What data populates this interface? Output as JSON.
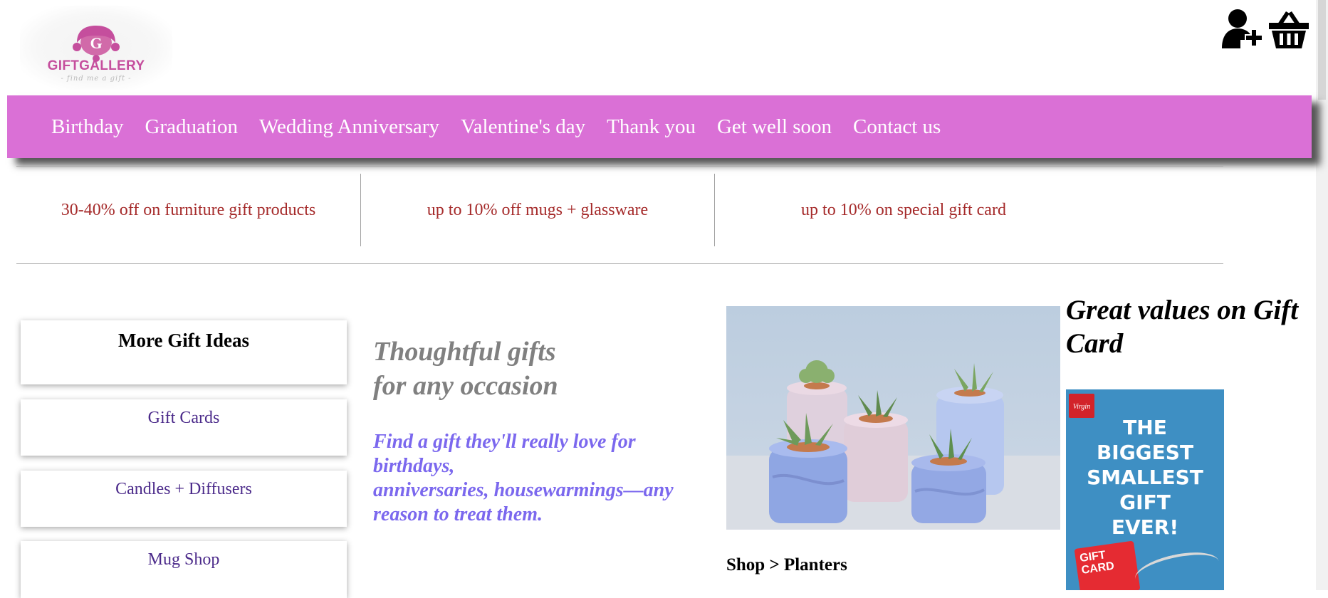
{
  "header": {
    "logo": {
      "brand": "GIFTGALLERY",
      "tagline": "- find me a gift -",
      "monogram": "G"
    },
    "icons": {
      "account": "add-user-icon",
      "cart": "basket-icon"
    }
  },
  "nav": {
    "items": [
      {
        "label": "Birthday"
      },
      {
        "label": "Graduation"
      },
      {
        "label": "Wedding Anniversary"
      },
      {
        "label": "Valentine's day"
      },
      {
        "label": "Thank you"
      },
      {
        "label": "Get well soon"
      },
      {
        "label": "Contact us"
      }
    ]
  },
  "promos": [
    {
      "text": "30-40% off on furniture gift products"
    },
    {
      "text": "up to 10% off mugs + glassware"
    },
    {
      "text": "up to 10% on special gift card"
    }
  ],
  "sidebar": {
    "title": "More Gift Ideas",
    "links": [
      {
        "label": "Gift Cards"
      },
      {
        "label": "Candles + Diffusers"
      },
      {
        "label": "Mug Shop"
      }
    ]
  },
  "hero": {
    "headline_line1": "Thoughtful gifts",
    "headline_line2": "for any occasion",
    "sub_line1": "Find a gift they'll really love for birthdays,",
    "sub_line2": "anniversaries, housewarmings—any reason to treat them."
  },
  "planters": {
    "breadcrumb": "Shop > Planters"
  },
  "gift_card": {
    "title": "Great values on Gift Card",
    "card_text": [
      "THE",
      "BIGGEST",
      "SMALLEST",
      "GIFT",
      "EVER!"
    ],
    "badge_text": "GIFT CARD",
    "logo_text": "Virgin"
  },
  "colors": {
    "nav_bg": "#da70d6",
    "promo_text": "#a52a2a",
    "link_text": "#4b2a8a",
    "sub_text": "#7b68ee",
    "headline_text": "#808080"
  }
}
